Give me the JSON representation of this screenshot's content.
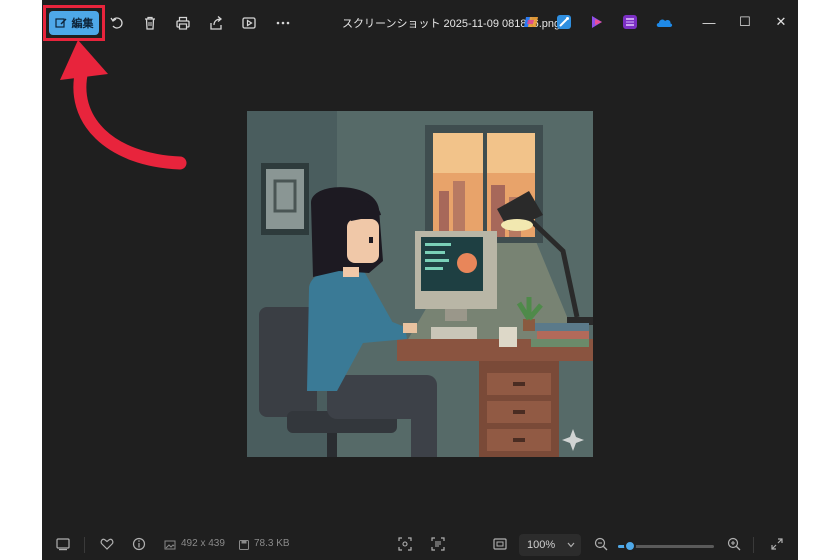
{
  "titlebar": {
    "edit_label": "編集",
    "filename": "スクリーンショット 2025-11-09 081816.png",
    "icons": [
      "rotate-icon",
      "delete-icon",
      "print-icon",
      "share-icon",
      "slideshow-icon",
      "more-icon"
    ],
    "apps": [
      "copilot-icon",
      "photos-editor-icon",
      "clipchamp-icon",
      "onenote-icon",
      "onedrive-icon"
    ],
    "minimize": "—",
    "maximize": "☐",
    "close": "✕"
  },
  "bottombar": {
    "dimensions": "492 x 439",
    "filesize": "78.3 KB",
    "zoom": "100%",
    "zoom_level": 0.12
  },
  "colors": {
    "accent": "#4ea8e8",
    "highlight": "#e8243c"
  }
}
